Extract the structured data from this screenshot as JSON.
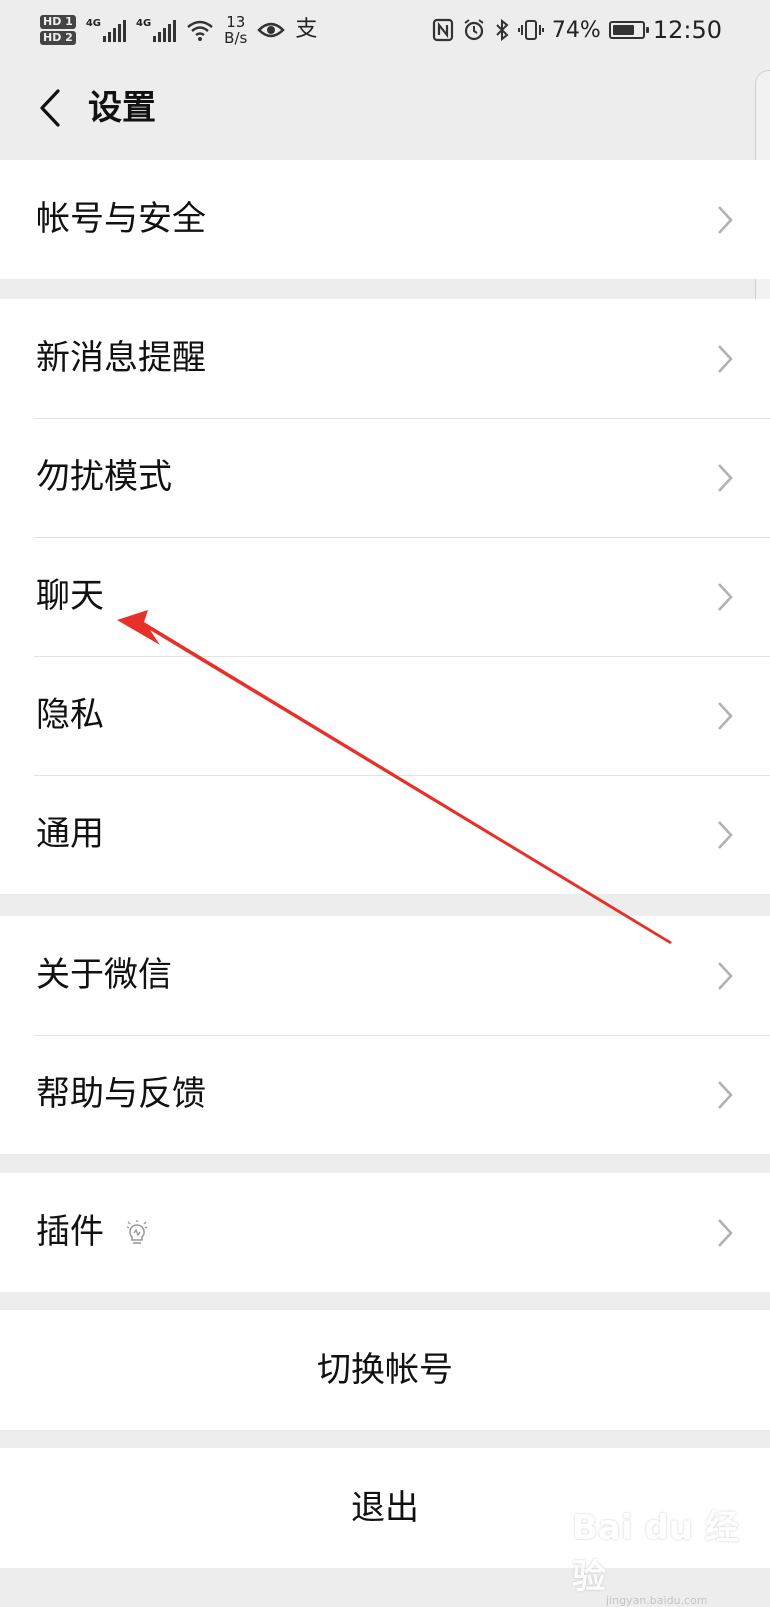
{
  "status_bar": {
    "network_left": "4G",
    "network_right": "4G",
    "hd1": "HD 1",
    "hd2": "HD 2",
    "speed_value": "13",
    "speed_unit": "B/s",
    "battery": "74%",
    "battery_level": 0.74,
    "time": "12:50"
  },
  "header": {
    "title": "设置"
  },
  "groups": {
    "account": {
      "security": "帐号与安全"
    },
    "prefs": {
      "notifications": "新消息提醒",
      "dnd": "勿扰模式",
      "chat": "聊天",
      "privacy": "隐私",
      "general": "通用"
    },
    "about": {
      "about": "关于微信",
      "help": "帮助与反馈"
    },
    "plugins": {
      "plugins": "插件"
    },
    "switch_account": "切换帐号",
    "logout": "退出"
  },
  "annotation": {
    "arrow_color": "#e8302a"
  },
  "watermark": {
    "brand": "Bai du 经验",
    "domain": "jingyan.baidu.com"
  },
  "colors": {
    "background": "#ededed",
    "surface": "#ffffff",
    "divider": "#e3e3e3",
    "chevron": "#b2b2b2"
  }
}
